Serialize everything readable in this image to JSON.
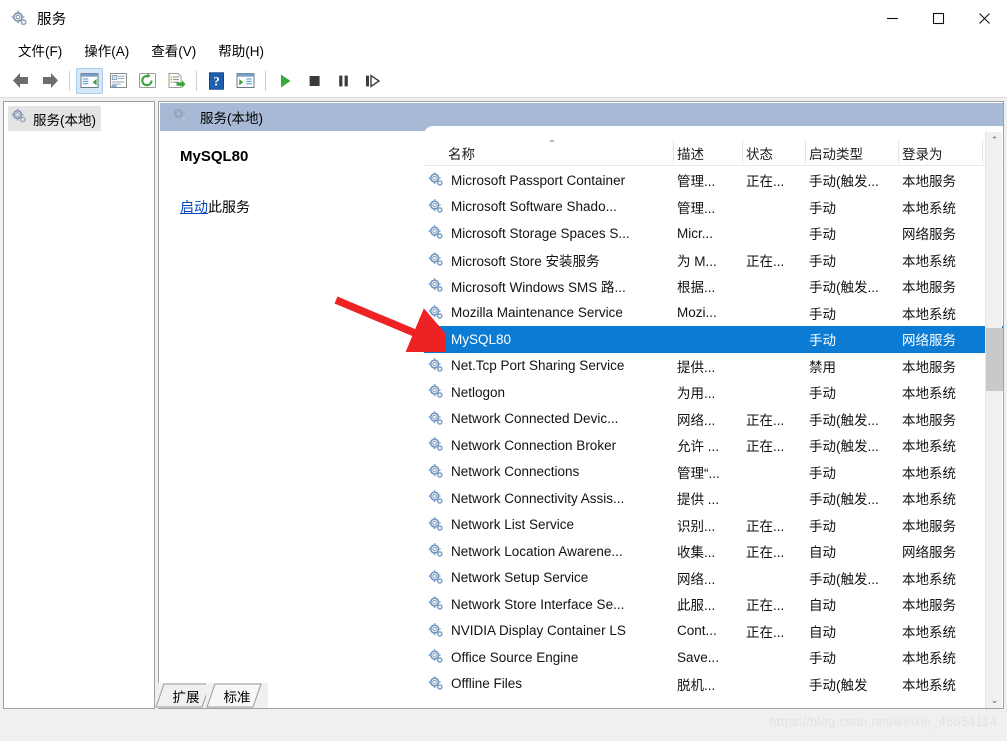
{
  "window": {
    "title": "服务",
    "icon": "services-gear-icon",
    "controls": {
      "minimize": "—",
      "maximize": "□",
      "close": "✕"
    }
  },
  "menu": {
    "items": [
      {
        "label": "文件(F)",
        "name": "menu-file"
      },
      {
        "label": "操作(A)",
        "name": "menu-action"
      },
      {
        "label": "查看(V)",
        "name": "menu-view"
      },
      {
        "label": "帮助(H)",
        "name": "menu-help"
      }
    ]
  },
  "toolbar": {
    "buttons": [
      {
        "name": "back-icon",
        "tip": "后退"
      },
      {
        "name": "forward-icon",
        "tip": "前进"
      },
      {
        "name": "show-hide-tree-icon",
        "tip": "显示/隐藏控制台树",
        "active": true
      },
      {
        "name": "properties-icon",
        "tip": "属性"
      },
      {
        "name": "refresh-icon",
        "tip": "刷新"
      },
      {
        "name": "export-list-icon",
        "tip": "导出列表"
      },
      {
        "name": "help-icon",
        "tip": "帮助"
      },
      {
        "name": "show-action-pane-icon",
        "tip": "显示/隐藏操作窗格"
      },
      {
        "name": "start-service-icon",
        "tip": "启动服务"
      },
      {
        "name": "stop-service-icon",
        "tip": "停止服务"
      },
      {
        "name": "pause-service-icon",
        "tip": "暂停服务"
      },
      {
        "name": "restart-service-icon",
        "tip": "重启服务"
      }
    ]
  },
  "tree": {
    "root": {
      "label": "服务(本地)",
      "icon": "services-gear-icon",
      "selected": true
    }
  },
  "pane": {
    "header": {
      "label": "服务(本地)",
      "icon": "services-gear-icon"
    },
    "details": {
      "service_name": "MySQL80",
      "action_link": "启动",
      "action_suffix": "此服务"
    }
  },
  "table": {
    "columns": [
      {
        "label": "名称",
        "name": "col-name",
        "sorted": true
      },
      {
        "label": "描述",
        "name": "col-desc"
      },
      {
        "label": "状态",
        "name": "col-status"
      },
      {
        "label": "启动类型",
        "name": "col-startup"
      },
      {
        "label": "登录为",
        "name": "col-logon"
      }
    ],
    "rows": [
      {
        "name": "Microsoft Passport Container",
        "desc": "管理...",
        "status": "正在...",
        "startup": "手动(触发...",
        "logon": "本地服务",
        "selected": false
      },
      {
        "name": "Microsoft Software Shado...",
        "desc": "管理...",
        "status": "",
        "startup": "手动",
        "logon": "本地系统",
        "selected": false
      },
      {
        "name": "Microsoft Storage Spaces S...",
        "desc": "Micr...",
        "status": "",
        "startup": "手动",
        "logon": "网络服务",
        "selected": false
      },
      {
        "name": "Microsoft Store 安装服务",
        "desc": "为 M...",
        "status": "正在...",
        "startup": "手动",
        "logon": "本地系统",
        "selected": false
      },
      {
        "name": "Microsoft Windows SMS 路...",
        "desc": "根据...",
        "status": "",
        "startup": "手动(触发...",
        "logon": "本地服务",
        "selected": false
      },
      {
        "name": "Mozilla Maintenance Service",
        "desc": "Mozi...",
        "status": "",
        "startup": "手动",
        "logon": "本地系统",
        "selected": false
      },
      {
        "name": "MySQL80",
        "desc": "",
        "status": "",
        "startup": "手动",
        "logon": "网络服务",
        "selected": true
      },
      {
        "name": "Net.Tcp Port Sharing Service",
        "desc": "提供...",
        "status": "",
        "startup": "禁用",
        "logon": "本地服务",
        "selected": false
      },
      {
        "name": "Netlogon",
        "desc": "为用...",
        "status": "",
        "startup": "手动",
        "logon": "本地系统",
        "selected": false
      },
      {
        "name": "Network Connected Devic...",
        "desc": "网络...",
        "status": "正在...",
        "startup": "手动(触发...",
        "logon": "本地服务",
        "selected": false
      },
      {
        "name": "Network Connection Broker",
        "desc": "允许 ...",
        "status": "正在...",
        "startup": "手动(触发...",
        "logon": "本地系统",
        "selected": false
      },
      {
        "name": "Network Connections",
        "desc": "管理“...",
        "status": "",
        "startup": "手动",
        "logon": "本地系统",
        "selected": false
      },
      {
        "name": "Network Connectivity Assis...",
        "desc": "提供 ...",
        "status": "",
        "startup": "手动(触发...",
        "logon": "本地系统",
        "selected": false
      },
      {
        "name": "Network List Service",
        "desc": "识别...",
        "status": "正在...",
        "startup": "手动",
        "logon": "本地服务",
        "selected": false
      },
      {
        "name": "Network Location Awarene...",
        "desc": "收集...",
        "status": "正在...",
        "startup": "自动",
        "logon": "网络服务",
        "selected": false
      },
      {
        "name": "Network Setup Service",
        "desc": "网络...",
        "status": "",
        "startup": "手动(触发...",
        "logon": "本地系统",
        "selected": false
      },
      {
        "name": "Network Store Interface Se...",
        "desc": "此服...",
        "status": "正在...",
        "startup": "自动",
        "logon": "本地服务",
        "selected": false
      },
      {
        "name": "NVIDIA Display Container LS",
        "desc": "Cont...",
        "status": "正在...",
        "startup": "自动",
        "logon": "本地系统",
        "selected": false
      },
      {
        "name": "Office  Source Engine",
        "desc": "Save...",
        "status": "",
        "startup": "手动",
        "logon": "本地系统",
        "selected": false
      },
      {
        "name": "Offline Files",
        "desc": "脱机...",
        "status": "",
        "startup": "手动(触发",
        "logon": "本地系统",
        "selected": false
      }
    ]
  },
  "tabs": [
    {
      "label": "扩展",
      "name": "tab-extended",
      "active": false
    },
    {
      "label": "标准",
      "name": "tab-standard",
      "active": true
    }
  ],
  "watermark": "https://blog.csdn.net/weixin_46654114",
  "colors": {
    "selection": "#0b7bd4",
    "pane_header": "#a7b9d4",
    "link": "#0645c0",
    "annotation_arrow": "#ee2222"
  },
  "scrollbar": {
    "up": "⌃",
    "down": "⌄"
  }
}
